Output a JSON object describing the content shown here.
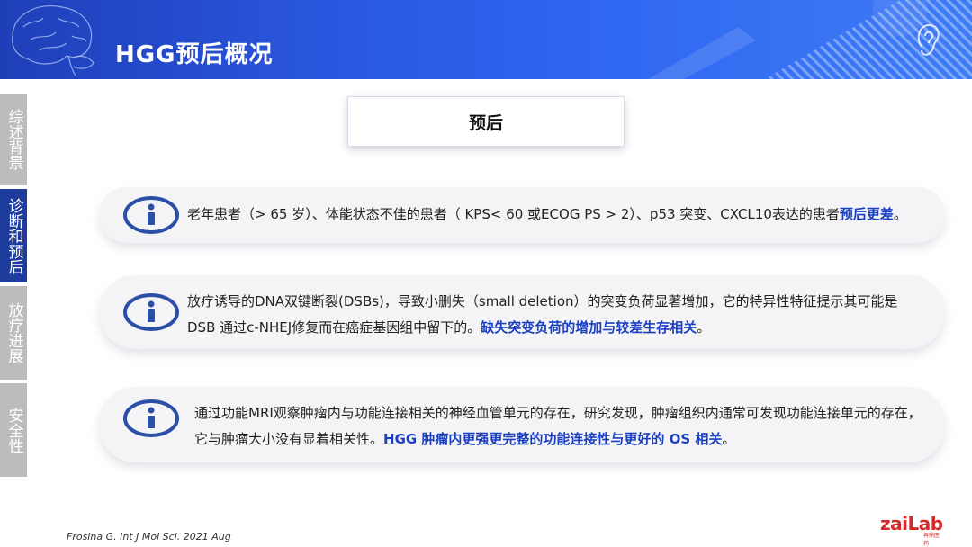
{
  "header": {
    "title": "HGG预后概况"
  },
  "sidenav": {
    "items": [
      {
        "label": "综述背景",
        "active": false
      },
      {
        "label": "诊断和预后",
        "active": true
      },
      {
        "label": "放疗进展",
        "active": false
      },
      {
        "label": "安全性",
        "active": false
      }
    ]
  },
  "main": {
    "title": "预后",
    "cards": [
      {
        "icon": "info-icon",
        "text": "老年患者（> 65 岁）、体能状态不佳的患者（ KPS< 60 或ECOG PS > 2）、p53 突变、CXCL10表达的患者",
        "highlight": "预后更差",
        "tail": "。"
      },
      {
        "icon": "info-icon",
        "text": "放疗诱导的DNA双键断裂(DSBs)，导致小删失（small deletion）的突变负荷显著增加，它的特异性特征提示其可能是DSB 通过c-NHEJ修复而在癌症基因组中留下的。",
        "highlight": "缺失突变负荷的增加与较差生存相关",
        "tail": "。"
      },
      {
        "icon": "info-icon",
        "text": "通过功能MRI观察肿瘤内与功能连接相关的神经血管单元的存在，研究发现，肿瘤组织内通常可发现功能连接单元的存在，它与肿瘤大小没有显着相关性。",
        "highlight": "HGG 肿瘤内更强更完整的功能连接性与更好的 OS 相关",
        "tail": "。"
      }
    ]
  },
  "footer": {
    "citation": "Frosina G. Int J Mol Sci. 2021 Aug",
    "logo_main": "zaiLab",
    "logo_sub": "再鼎医药"
  },
  "colors": {
    "accent": "#1a3fc0",
    "nav_active": "#1e3c9c",
    "nav_inactive": "#bcbcbc",
    "logo": "#d42a2a"
  }
}
